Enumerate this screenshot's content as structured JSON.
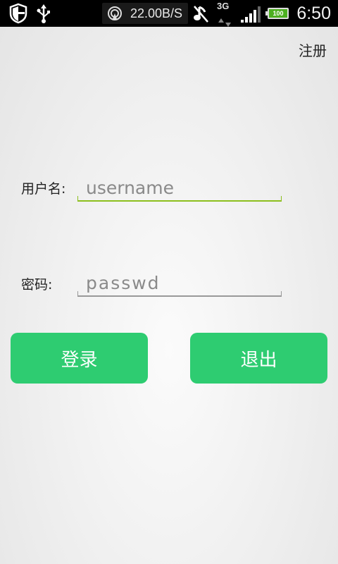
{
  "statusbar": {
    "net_speed": "22.00B/S",
    "network_type": "3G",
    "battery_level": "100",
    "time": "6:50",
    "icons": [
      "shield-icon",
      "usb-icon",
      "hotspot-icon",
      "music-off-icon",
      "signal-icon",
      "battery-icon"
    ]
  },
  "header": {
    "register_label": "注册"
  },
  "form": {
    "username_label": "用户名:",
    "username_placeholder": "username",
    "password_label": "密码:",
    "password_placeholder": "passwd"
  },
  "buttons": {
    "login_label": "登录",
    "exit_label": "退出"
  },
  "colors": {
    "button": "#2ecc71",
    "active_underline": "#8cbf1d"
  }
}
